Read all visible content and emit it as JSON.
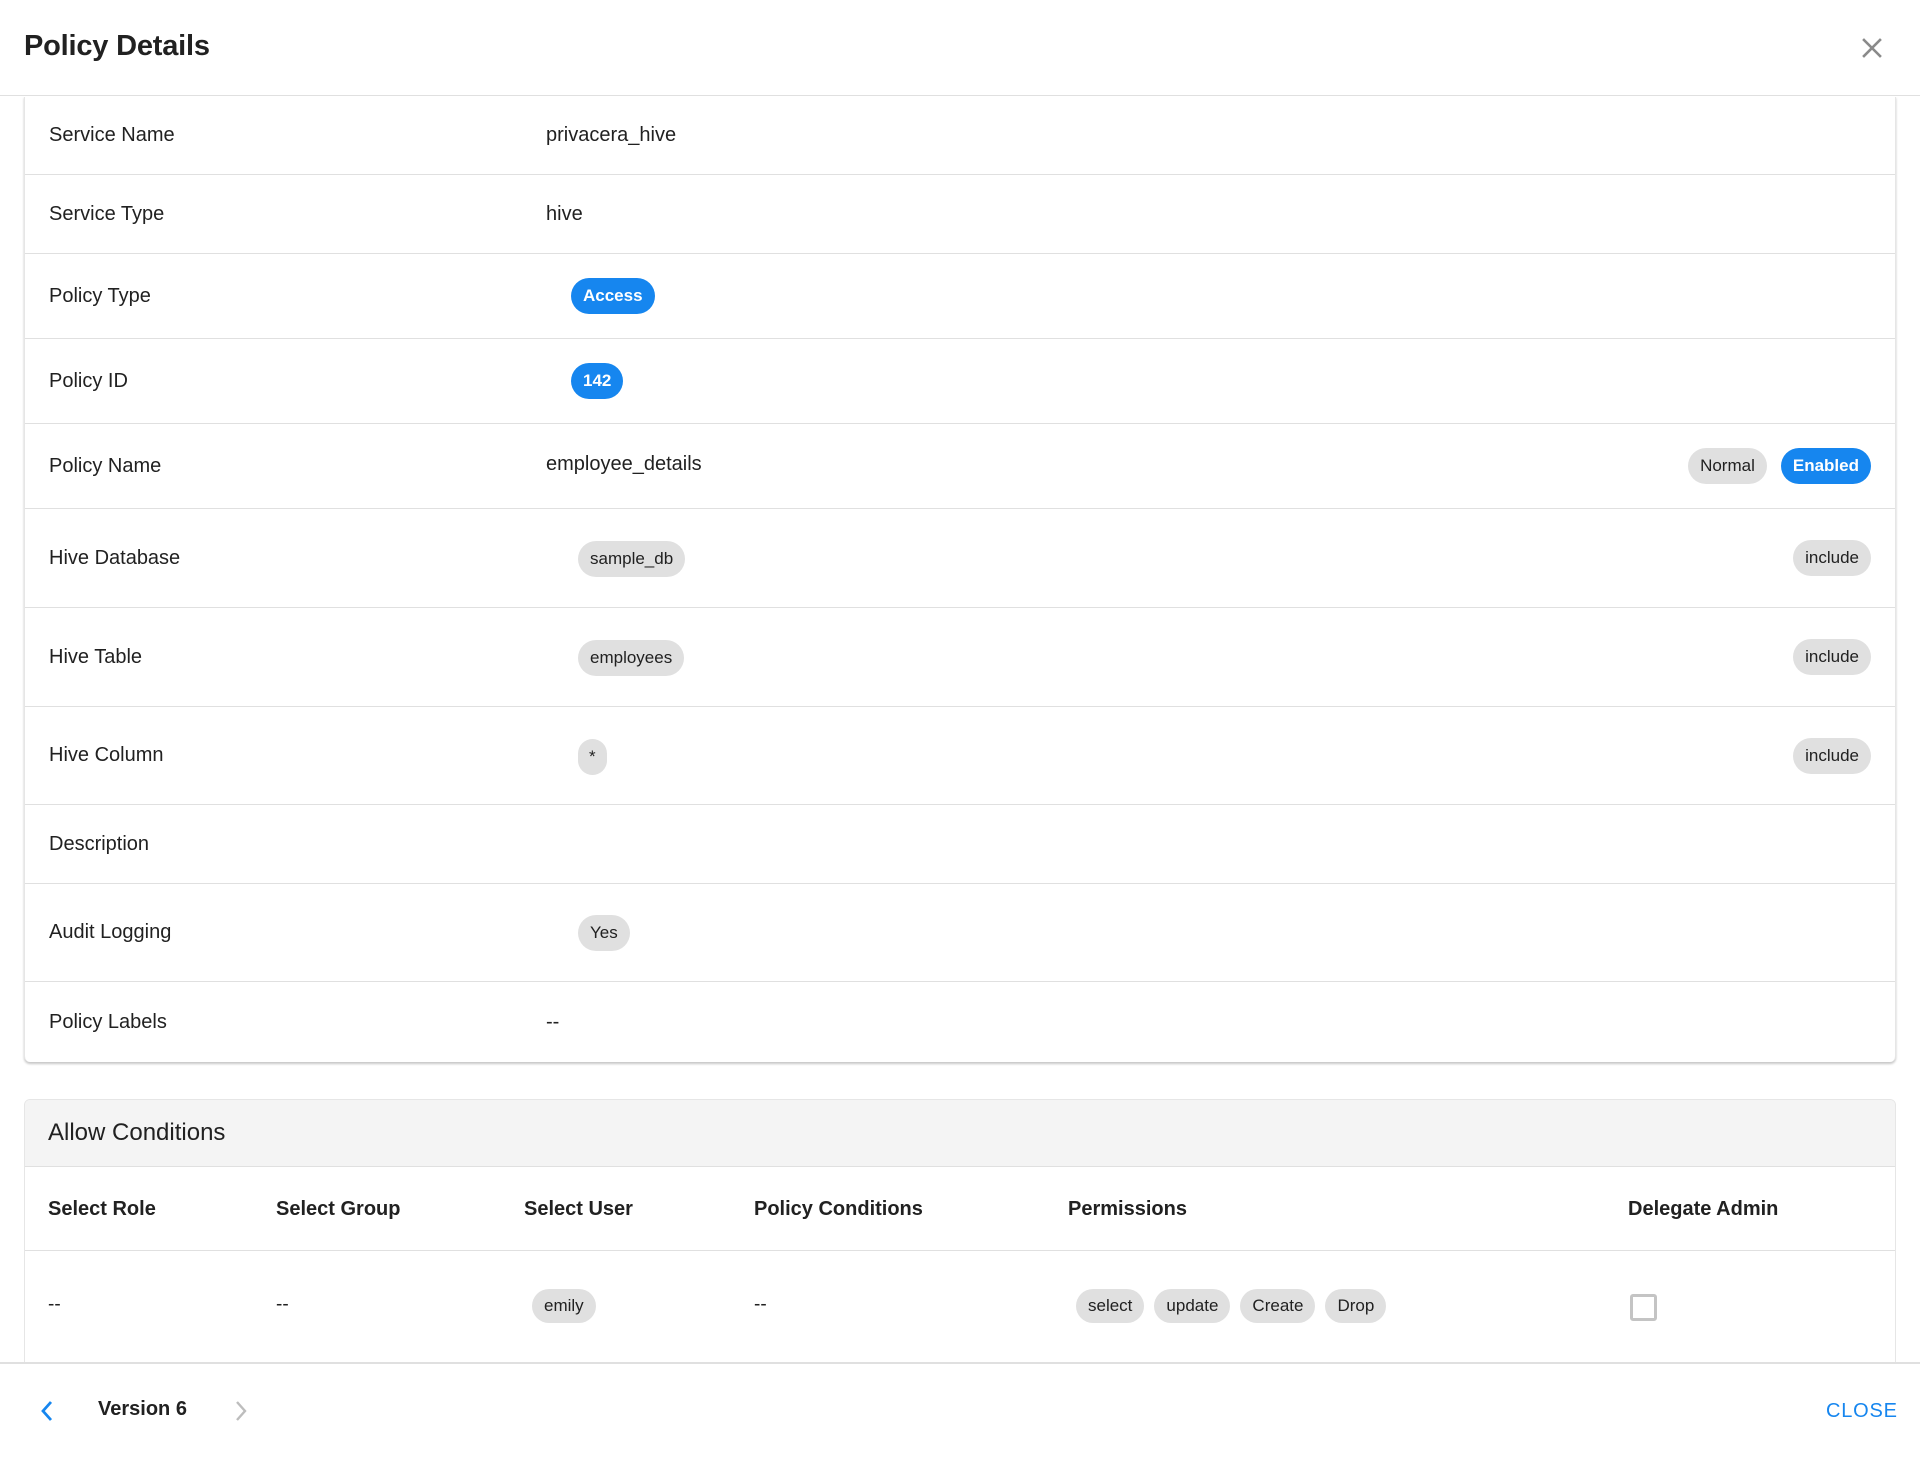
{
  "dialog": {
    "title": "Policy Details",
    "close_icon": "close-icon"
  },
  "details": {
    "service_name": {
      "label": "Service Name",
      "value": "privacera_hive"
    },
    "service_type": {
      "label": "Service Type",
      "value": "hive"
    },
    "policy_type": {
      "label": "Policy Type",
      "value": "Access"
    },
    "policy_id": {
      "label": "Policy ID",
      "value": "142"
    },
    "policy_name": {
      "label": "Policy Name",
      "value": "employee_details",
      "priority_badge": "Normal",
      "status_badge": "Enabled"
    },
    "hive_database": {
      "label": "Hive Database",
      "value": "sample_db",
      "mode": "include"
    },
    "hive_table": {
      "label": "Hive Table",
      "value": "employees",
      "mode": "include"
    },
    "hive_column": {
      "label": "Hive Column",
      "value": "*",
      "mode": "include"
    },
    "description": {
      "label": "Description",
      "value": ""
    },
    "audit_logging": {
      "label": "Audit Logging",
      "value": "Yes"
    },
    "policy_labels": {
      "label": "Policy Labels",
      "value": "--"
    }
  },
  "allow_conditions": {
    "title": "Allow Conditions",
    "columns": [
      "Select Role",
      "Select Group",
      "Select User",
      "Policy Conditions",
      "Permissions",
      "Delegate Admin"
    ],
    "rows": [
      {
        "role": "--",
        "group": "--",
        "user": "emily",
        "conditions": "--",
        "permissions": [
          "select",
          "update",
          "Create",
          "Drop"
        ],
        "delegate_admin": false
      }
    ]
  },
  "footer": {
    "version_label": "Version 6",
    "prev_icon": "chevron-left-icon",
    "next_icon": "chevron-right-icon",
    "close_label": "CLOSE"
  },
  "colors": {
    "accent": "#1686ef",
    "chip_bg": "#e0e0e0",
    "divider": "#e0e0e0"
  }
}
